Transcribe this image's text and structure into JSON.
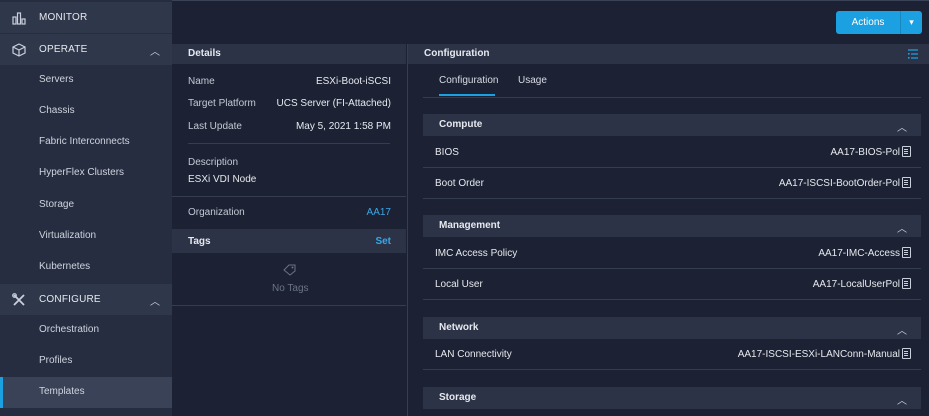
{
  "sidebar": {
    "monitor": {
      "label": "MONITOR",
      "icon": "bar-chart-icon"
    },
    "operate": {
      "label": "OPERATE",
      "icon": "cube-icon",
      "items": [
        "Servers",
        "Chassis",
        "Fabric Interconnects",
        "HyperFlex Clusters",
        "Storage",
        "Virtualization",
        "Kubernetes"
      ]
    },
    "configure": {
      "label": "CONFIGURE",
      "icon": "tools-icon",
      "items": [
        "Orchestration",
        "Profiles",
        "Templates"
      ],
      "active": "Templates"
    }
  },
  "header": {
    "actions_label": "Actions"
  },
  "details": {
    "title": "Details",
    "name_label": "Name",
    "name_value": "ESXi-Boot-iSCSI",
    "platform_label": "Target Platform",
    "platform_value": "UCS Server (FI-Attached)",
    "update_label": "Last Update",
    "update_value": "May 5, 2021 1:58 PM",
    "description_label": "Description",
    "description_value": "ESXi VDI Node",
    "org_label": "Organization",
    "org_value": "AA17",
    "tags_label": "Tags",
    "tags_action": "Set",
    "no_tags": "No Tags"
  },
  "configuration": {
    "title": "Configuration",
    "tabs": [
      "Configuration",
      "Usage"
    ],
    "groups": {
      "compute": {
        "label": "Compute",
        "rows": [
          {
            "label": "BIOS",
            "value": "AA17-BIOS-Pol"
          },
          {
            "label": "Boot Order",
            "value": "AA17-ISCSI-BootOrder-Pol"
          }
        ]
      },
      "management": {
        "label": "Management",
        "rows": [
          {
            "label": "IMC Access Policy",
            "value": "AA17-IMC-Access"
          },
          {
            "label": "Local User",
            "value": "AA17-LocalUserPol"
          }
        ]
      },
      "network": {
        "label": "Network",
        "rows": [
          {
            "label": "LAN Connectivity",
            "value": "AA17-ISCSI-ESXi-LANConn-Manual"
          }
        ]
      },
      "storage": {
        "label": "Storage"
      }
    }
  },
  "colors": {
    "accent": "#1ba0e2",
    "background": "#1c2233",
    "panel": "#2c3346"
  }
}
